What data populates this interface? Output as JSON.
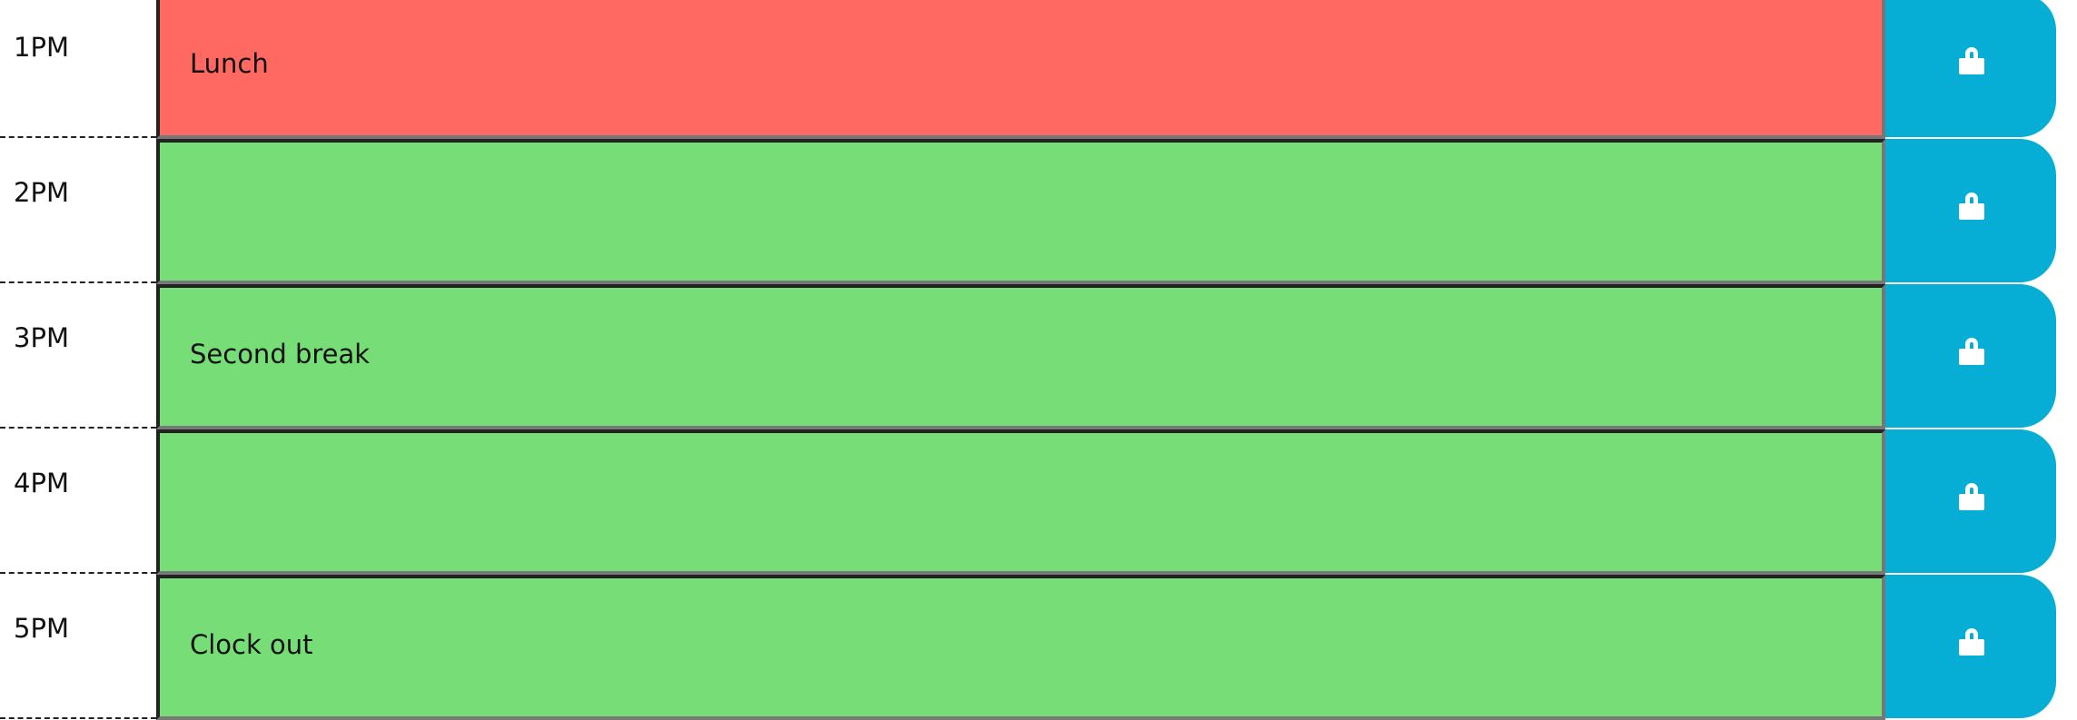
{
  "colors": {
    "past": "#ff6961",
    "future": "#77dd77",
    "save": "#06aed5"
  },
  "rows": [
    {
      "hour": "1PM",
      "text": "Lunch",
      "state": "past",
      "icon": "lock-icon"
    },
    {
      "hour": "2PM",
      "text": "",
      "state": "future",
      "icon": "lock-icon"
    },
    {
      "hour": "3PM",
      "text": "Second break",
      "state": "future",
      "icon": "lock-icon"
    },
    {
      "hour": "4PM",
      "text": "",
      "state": "future",
      "icon": "lock-icon"
    },
    {
      "hour": "5PM",
      "text": "Clock out",
      "state": "future",
      "icon": "lock-icon"
    }
  ]
}
